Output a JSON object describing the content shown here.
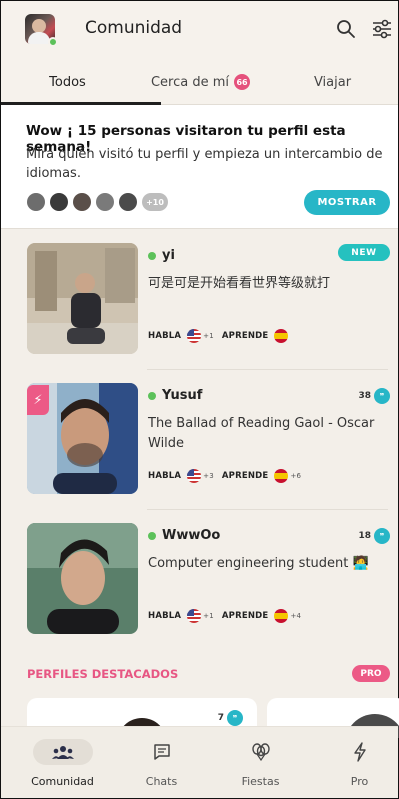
{
  "header": {
    "title": "Comunidad",
    "search_icon": "search-icon",
    "filter_icon": "sliders-icon"
  },
  "tabs": [
    {
      "label": "Todos",
      "active": true
    },
    {
      "label": "Cerca de mí",
      "badge": "66"
    },
    {
      "label": "Viajar"
    }
  ],
  "visitors": {
    "title": "Wow ¡ 15 personas visitaron tu perfil esta semana!",
    "text": "Mira quién visitó tu perfil y empieza un intercambio de idiomas.",
    "more": "+10",
    "button": "MOSTRAR"
  },
  "langs": {
    "speaks": "HABLA",
    "learns": "APRENDE"
  },
  "profiles": [
    {
      "name": "yi",
      "desc": "可是可是开始看看世界等级就打",
      "tag": "NEW",
      "speaks_extra": "+1",
      "learns_extra": ""
    },
    {
      "name": "Yusuf",
      "desc": "The Ballad of Reading Gaol - Oscar Wilde",
      "count": "38",
      "speaks_extra": "+3",
      "learns_extra": "+6"
    },
    {
      "name": "WwwOo",
      "desc": "Computer engineering student 🧑‍💻",
      "count": "18",
      "speaks_extra": "+1",
      "learns_extra": "+4"
    }
  ],
  "featured": {
    "title": "PERFILES DESTACADOS",
    "pill": "PRO",
    "count": "7"
  },
  "bottom_nav": [
    {
      "label": "Comunidad",
      "icon": "community-icon",
      "active": true
    },
    {
      "label": "Chats",
      "icon": "chat-icon"
    },
    {
      "label": "Fiestas",
      "icon": "balloons-icon"
    },
    {
      "label": "Pro",
      "icon": "bolt-icon"
    }
  ],
  "colors": {
    "accent": "#27b6c7",
    "pink": "#e75683",
    "online": "#5cc15a"
  }
}
